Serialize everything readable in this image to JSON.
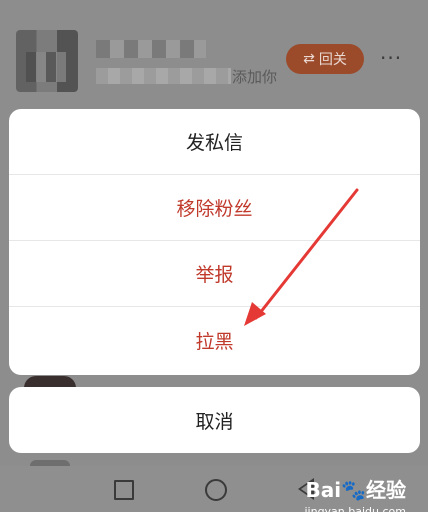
{
  "user_row": {
    "added_text": "添加你",
    "follow_button": {
      "icon": "⇄",
      "label": "回关"
    },
    "more_icon": "···"
  },
  "sheet": {
    "items": [
      {
        "label": "发私信",
        "style": "normal"
      },
      {
        "label": "移除粉丝",
        "style": "danger"
      },
      {
        "label": "举报",
        "style": "danger"
      },
      {
        "label": "拉黑",
        "style": "danger"
      }
    ],
    "cancel_label": "取消"
  },
  "colors": {
    "danger": "#c0392b",
    "annotation_arrow": "#e53935",
    "follow_button": "#9b4a2a"
  },
  "watermark": {
    "logo_text": "Bai🐾经验",
    "url": "jingyan.baidu.com"
  }
}
